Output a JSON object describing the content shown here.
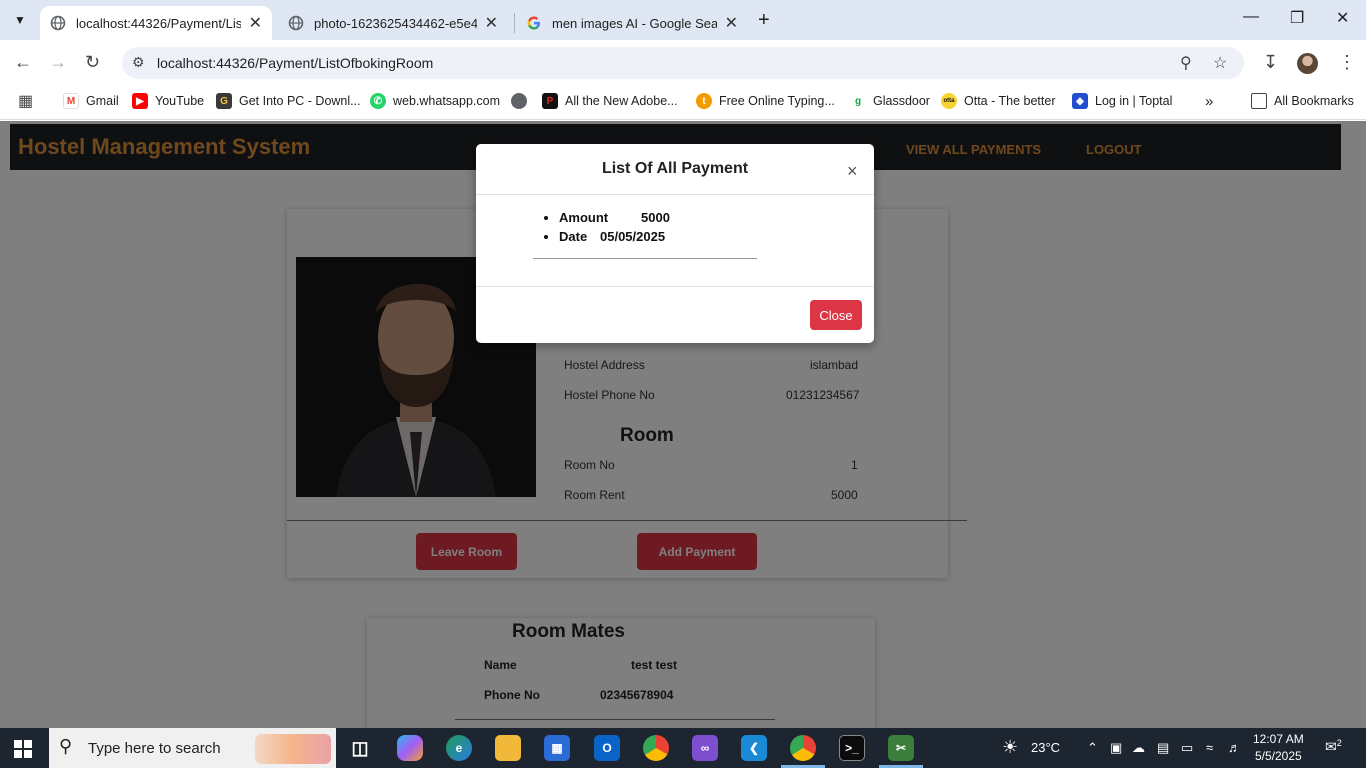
{
  "browser": {
    "tabs": [
      {
        "title": "localhost:44326/Payment/ListOf",
        "active": true
      },
      {
        "title": "photo-1623625434462-e5e423",
        "active": false
      },
      {
        "title": "men images AI - Google Search",
        "active": false
      }
    ],
    "url": "localhost:44326/Payment/ListOfbokingRoom",
    "bookmarks": [
      "Gmail",
      "YouTube",
      "Get Into PC - Downl...",
      "web.whatsapp.com",
      "All the New Adobe...",
      "Free Online Typing...",
      "Glassdoor",
      "Otta - The better",
      "Log in | Toptal"
    ],
    "all_bookmarks": "All Bookmarks"
  },
  "app": {
    "brand": "Hostel Management System",
    "nav": [
      "VIEW ALL PAYMENTS",
      "LOGOUT"
    ]
  },
  "hostel": {
    "address_label": "Hostel Address",
    "address": "islambad",
    "phone_label": "Hostel Phone No",
    "phone": "01231234567"
  },
  "room": {
    "heading": "Room",
    "no_label": "Room No",
    "no": "1",
    "rent_label": "Room Rent",
    "rent": "5000"
  },
  "actions": {
    "leave": "Leave Room",
    "add_payment": "Add Payment"
  },
  "roommates": {
    "heading": "Room Mates",
    "name_label": "Name",
    "name": "test test",
    "phone_label": "Phone No",
    "phone": "02345678904"
  },
  "modal": {
    "title": "List Of All Payment",
    "amount_label": "Amount",
    "amount": "5000",
    "date_label": "Date",
    "date": "05/05/2025",
    "close": "Close"
  },
  "taskbar": {
    "search_placeholder": "Type here to search",
    "temperature": "23°C",
    "time": "12:07 AM",
    "date": "5/5/2025",
    "notifications": "2"
  }
}
